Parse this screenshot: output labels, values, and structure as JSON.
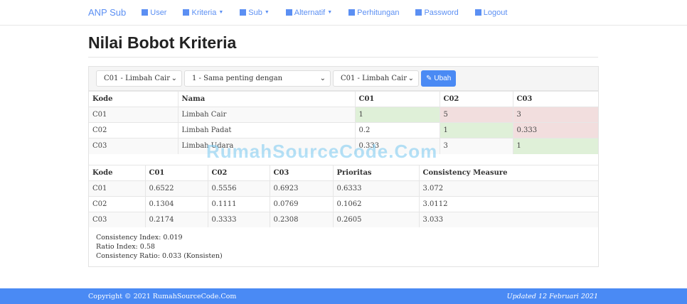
{
  "nav": {
    "brand": "ANP Sub",
    "items": [
      {
        "label": "User",
        "icon": "user-icon",
        "dropdown": false
      },
      {
        "label": "Kriteria",
        "icon": "grid-icon",
        "dropdown": true
      },
      {
        "label": "Sub",
        "icon": "grid-icon",
        "dropdown": true
      },
      {
        "label": "Alternatif",
        "icon": "user-icon",
        "dropdown": true
      },
      {
        "label": "Perhitungan",
        "icon": "calendar-icon",
        "dropdown": false
      },
      {
        "label": "Password",
        "icon": "lock-icon",
        "dropdown": false
      },
      {
        "label": "Logout",
        "icon": "logout-icon",
        "dropdown": false
      }
    ]
  },
  "page_title": "Nilai Bobot Kriteria",
  "form": {
    "kriteria1": "C01 - Limbah Cair",
    "nilai": "1 - Sama penting dengan",
    "kriteria2": "C01 - Limbah Cair",
    "submit": "Ubah"
  },
  "matrix": {
    "headers": [
      "Kode",
      "Nama",
      "C01",
      "C02",
      "C03"
    ],
    "rows": [
      [
        "C01",
        "Limbah Cair",
        "1",
        "5",
        "3"
      ],
      [
        "C02",
        "Limbah Padat",
        "0.2",
        "1",
        "0.333"
      ],
      [
        "C03",
        "Limbah Udara",
        "0.333",
        "3",
        "1"
      ]
    ]
  },
  "normal": {
    "headers": [
      "Kode",
      "C01",
      "C02",
      "C03",
      "Prioritas",
      "Consistency Measure"
    ],
    "rows": [
      [
        "C01",
        "0.6522",
        "0.5556",
        "0.6923",
        "0.6333",
        "3.072"
      ],
      [
        "C02",
        "0.1304",
        "0.1111",
        "0.0769",
        "0.1062",
        "3.0112"
      ],
      [
        "C03",
        "0.2174",
        "0.3333",
        "0.2308",
        "0.2605",
        "3.033"
      ]
    ]
  },
  "consistency": {
    "ci": "Consistency Index: 0.019",
    "ri": "Ratio Index: 0.58",
    "cr": "Consistency Ratio: 0.033 (Konsisten)"
  },
  "watermark": "RumahSourceCode.Com",
  "footer": {
    "copyright": "Copyright © 2021 RumahSourceCode.Com",
    "updated": "Updated 12 Februari 2021"
  },
  "colors": {
    "accent": "#4a8af4",
    "green": "#dff0d8",
    "red": "#f2dede"
  }
}
